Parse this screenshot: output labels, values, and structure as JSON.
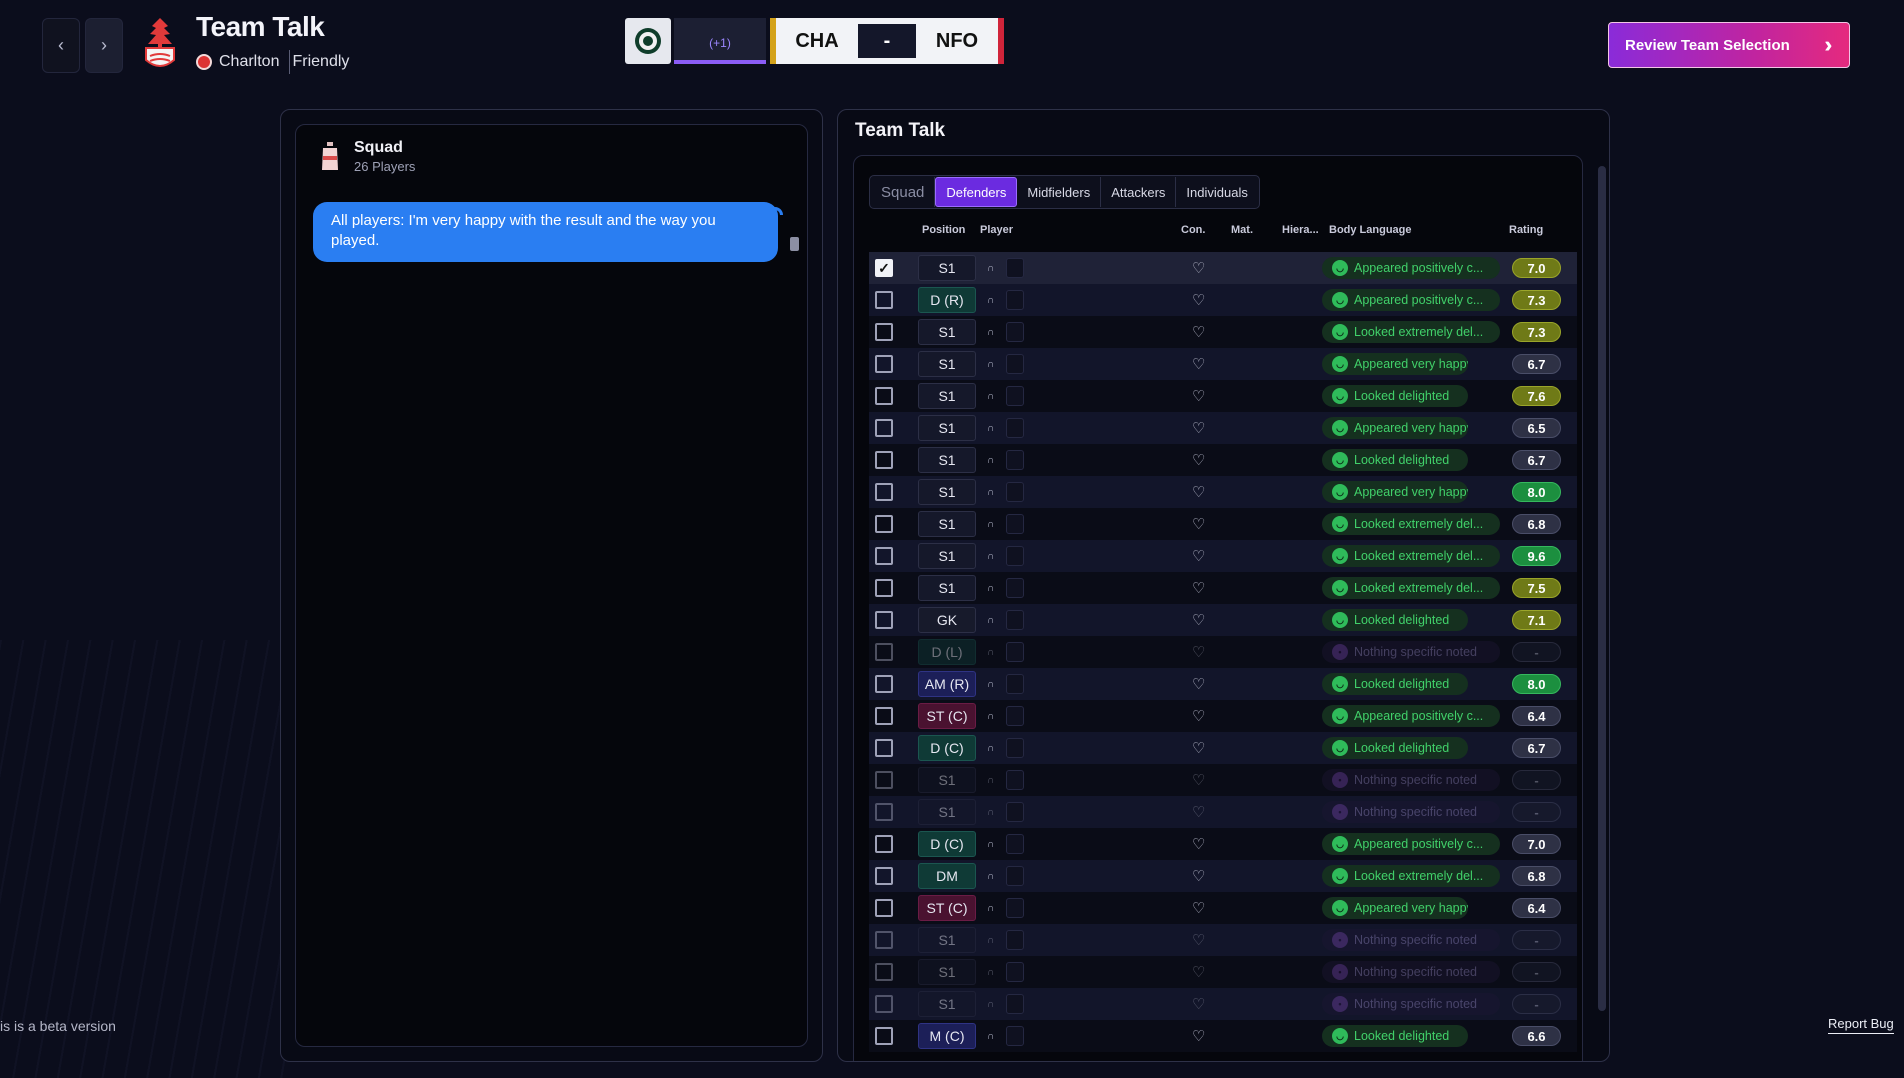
{
  "header": {
    "title": "Team Talk",
    "club": "Charlton",
    "match_type": "Friendly",
    "prev_icon": "chevron-left-icon",
    "next_icon": "chevron-right-icon"
  },
  "scoreboard": {
    "extra": "(+1)",
    "home": "CHA",
    "separator": "-",
    "away": "NFO"
  },
  "review_button": {
    "label": "Review Team Selection",
    "icon": "double-chevron-right-icon"
  },
  "squad_panel": {
    "name": "Squad",
    "count": "26 Players",
    "message": "All players: I'm very happy with the result and the way you played."
  },
  "team_talk": {
    "title": "Team Talk",
    "tabs": [
      "Squad",
      "Defenders",
      "Midfielders",
      "Attackers",
      "Individuals"
    ],
    "active_tab": "Defenders",
    "columns": {
      "position": "Position",
      "player": "Player",
      "con": "Con.",
      "mat": "Mat.",
      "hiera": "Hiera...",
      "body": "Body Language",
      "rating": "Rating"
    },
    "rows": [
      {
        "checked": true,
        "position": "S1",
        "pos_type": "none",
        "body": "Appeared positively c...",
        "mood": "happy",
        "rating": "7.0",
        "rating_style": "olive"
      },
      {
        "checked": false,
        "position": "D (R)",
        "pos_type": "def",
        "body": "Appeared positively c...",
        "mood": "happy",
        "rating": "7.3",
        "rating_style": "olive"
      },
      {
        "checked": false,
        "position": "S1",
        "pos_type": "none",
        "body": "Looked extremely del...",
        "mood": "happy",
        "rating": "7.3",
        "rating_style": "olive"
      },
      {
        "checked": false,
        "position": "S1",
        "pos_type": "none",
        "body": "Appeared very happy",
        "mood": "happy",
        "rating": "6.7",
        "rating_style": "grey"
      },
      {
        "checked": false,
        "position": "S1",
        "pos_type": "none",
        "body": "Looked delighted",
        "mood": "happy",
        "rating": "7.6",
        "rating_style": "olive"
      },
      {
        "checked": false,
        "position": "S1",
        "pos_type": "none",
        "body": "Appeared very happy",
        "mood": "happy",
        "rating": "6.5",
        "rating_style": "grey"
      },
      {
        "checked": false,
        "position": "S1",
        "pos_type": "none",
        "body": "Looked delighted",
        "mood": "happy",
        "rating": "6.7",
        "rating_style": "grey"
      },
      {
        "checked": false,
        "position": "S1",
        "pos_type": "none",
        "body": "Appeared very happy",
        "mood": "happy",
        "rating": "8.0",
        "rating_style": "green"
      },
      {
        "checked": false,
        "position": "S1",
        "pos_type": "none",
        "body": "Looked extremely del...",
        "mood": "happy",
        "rating": "6.8",
        "rating_style": "grey"
      },
      {
        "checked": false,
        "position": "S1",
        "pos_type": "none",
        "body": "Looked extremely del...",
        "mood": "happy",
        "rating": "9.6",
        "rating_style": "green"
      },
      {
        "checked": false,
        "position": "S1",
        "pos_type": "none",
        "body": "Looked extremely del...",
        "mood": "happy",
        "rating": "7.5",
        "rating_style": "olive"
      },
      {
        "checked": false,
        "position": "GK",
        "pos_type": "gk",
        "body": "Looked delighted",
        "mood": "happy",
        "rating": "7.1",
        "rating_style": "olive"
      },
      {
        "checked": false,
        "position": "D (L)",
        "pos_type": "def",
        "body": "Nothing specific noted",
        "mood": "neutral",
        "rating": "-",
        "rating_style": "none",
        "dim": true
      },
      {
        "checked": false,
        "position": "AM (R)",
        "pos_type": "mid",
        "body": "Looked delighted",
        "mood": "happy",
        "rating": "8.0",
        "rating_style": "green"
      },
      {
        "checked": false,
        "position": "ST (C)",
        "pos_type": "att",
        "body": "Appeared positively c...",
        "mood": "happy",
        "rating": "6.4",
        "rating_style": "grey"
      },
      {
        "checked": false,
        "position": "D (C)",
        "pos_type": "def",
        "body": "Looked delighted",
        "mood": "happy",
        "rating": "6.7",
        "rating_style": "grey"
      },
      {
        "checked": false,
        "position": "S1",
        "pos_type": "none",
        "body": "Nothing specific noted",
        "mood": "neutral",
        "rating": "-",
        "rating_style": "none",
        "dim": true
      },
      {
        "checked": false,
        "position": "S1",
        "pos_type": "none",
        "body": "Nothing specific noted",
        "mood": "neutral",
        "rating": "-",
        "rating_style": "none",
        "dim": true
      },
      {
        "checked": false,
        "position": "D (C)",
        "pos_type": "def",
        "body": "Appeared positively c...",
        "mood": "happy",
        "rating": "7.0",
        "rating_style": "grey"
      },
      {
        "checked": false,
        "position": "DM",
        "pos_type": "def",
        "body": "Looked extremely del...",
        "mood": "happy",
        "rating": "6.8",
        "rating_style": "grey"
      },
      {
        "checked": false,
        "position": "ST (C)",
        "pos_type": "att",
        "body": "Appeared very happy",
        "mood": "happy",
        "rating": "6.4",
        "rating_style": "grey"
      },
      {
        "checked": false,
        "position": "S1",
        "pos_type": "none",
        "body": "Nothing specific noted",
        "mood": "neutral",
        "rating": "-",
        "rating_style": "none",
        "dim": true
      },
      {
        "checked": false,
        "position": "S1",
        "pos_type": "none",
        "body": "Nothing specific noted",
        "mood": "neutral",
        "rating": "-",
        "rating_style": "none",
        "dim": true
      },
      {
        "checked": false,
        "position": "S1",
        "pos_type": "none",
        "body": "Nothing specific noted",
        "mood": "neutral",
        "rating": "-",
        "rating_style": "none",
        "dim": true
      },
      {
        "checked": false,
        "position": "M (C)",
        "pos_type": "mid",
        "body": "Looked delighted",
        "mood": "happy",
        "rating": "6.6",
        "rating_style": "grey"
      }
    ]
  },
  "footer": {
    "beta": "is is a beta version",
    "report_bug": "Report Bug"
  },
  "colors": {
    "background": "#0b0d1c",
    "accent_purple": "#6b2be0",
    "message_blue": "#2a7ef2",
    "happy_green": "#41d16a"
  }
}
